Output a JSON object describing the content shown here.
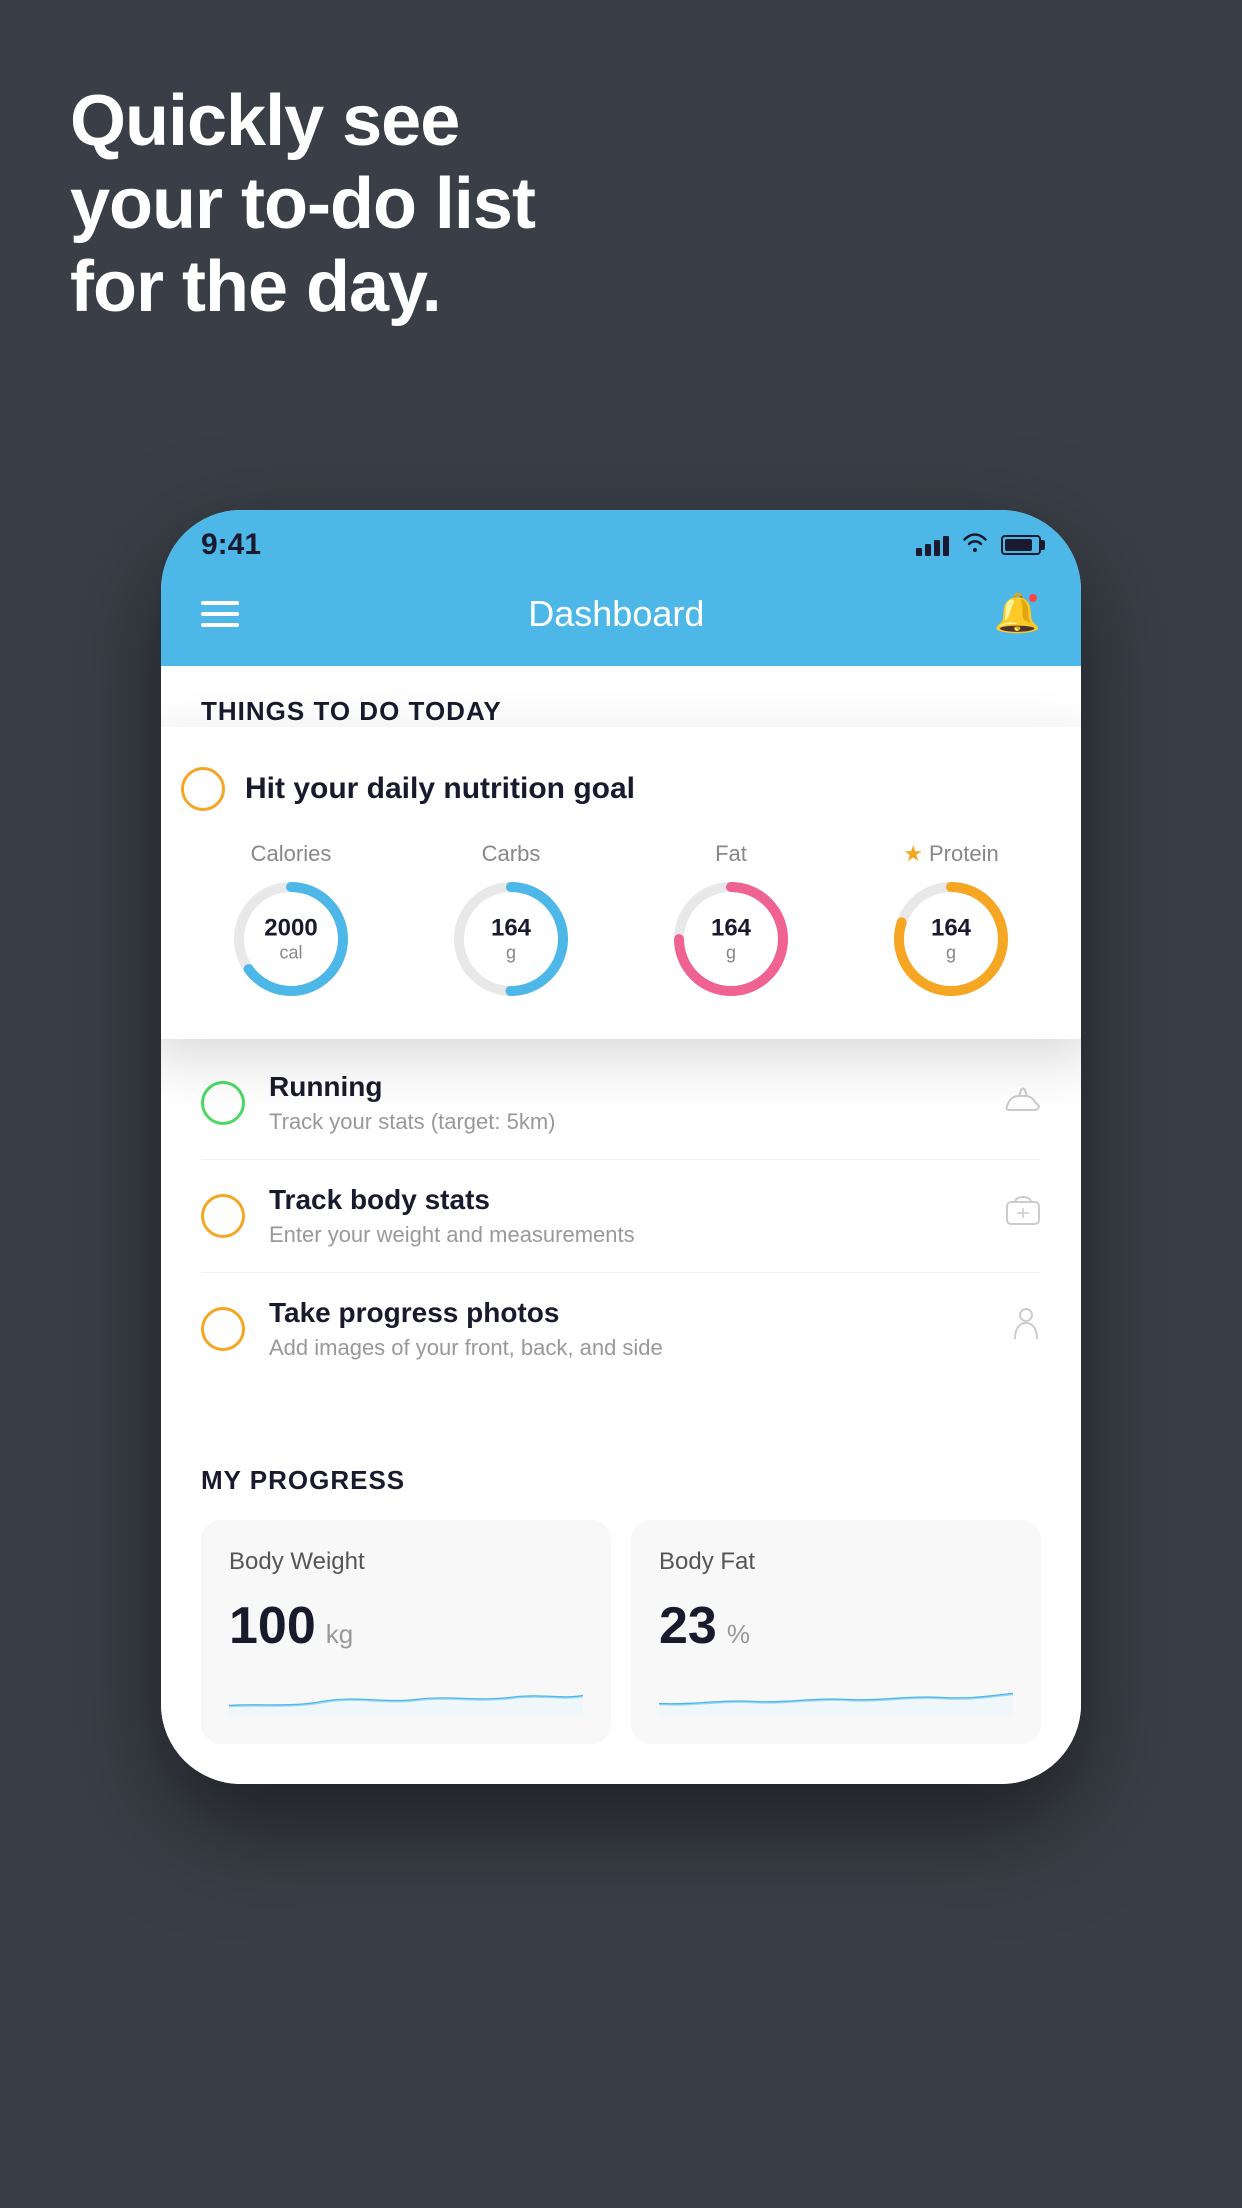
{
  "hero": {
    "line1": "Quickly see",
    "line2": "your to-do list",
    "line3": "for the day."
  },
  "statusBar": {
    "time": "9:41"
  },
  "navBar": {
    "title": "Dashboard"
  },
  "thingsToDoSection": {
    "header": "THINGS TO DO TODAY"
  },
  "floatingCard": {
    "checkbox_color": "yellow",
    "title": "Hit your daily nutrition goal",
    "nutrition": [
      {
        "label": "Calories",
        "value": "2000",
        "unit": "cal",
        "color": "#4db8e8",
        "highlight": false,
        "percent": 65
      },
      {
        "label": "Carbs",
        "value": "164",
        "unit": "g",
        "color": "#4db8e8",
        "highlight": false,
        "percent": 50
      },
      {
        "label": "Fat",
        "value": "164",
        "unit": "g",
        "color": "#f06292",
        "highlight": false,
        "percent": 75
      },
      {
        "label": "Protein",
        "value": "164",
        "unit": "g",
        "color": "#f5a623",
        "highlight": true,
        "percent": 80
      }
    ]
  },
  "todoItems": [
    {
      "title": "Running",
      "subtitle": "Track your stats (target: 5km)",
      "checkbox": "green",
      "icon": "shoe"
    },
    {
      "title": "Track body stats",
      "subtitle": "Enter your weight and measurements",
      "checkbox": "yellow",
      "icon": "scale"
    },
    {
      "title": "Take progress photos",
      "subtitle": "Add images of your front, back, and side",
      "checkbox": "yellow",
      "icon": "person"
    }
  ],
  "progressSection": {
    "title": "MY PROGRESS",
    "cards": [
      {
        "title": "Body Weight",
        "value": "100",
        "unit": "kg"
      },
      {
        "title": "Body Fat",
        "value": "23",
        "unit": "%"
      }
    ]
  }
}
